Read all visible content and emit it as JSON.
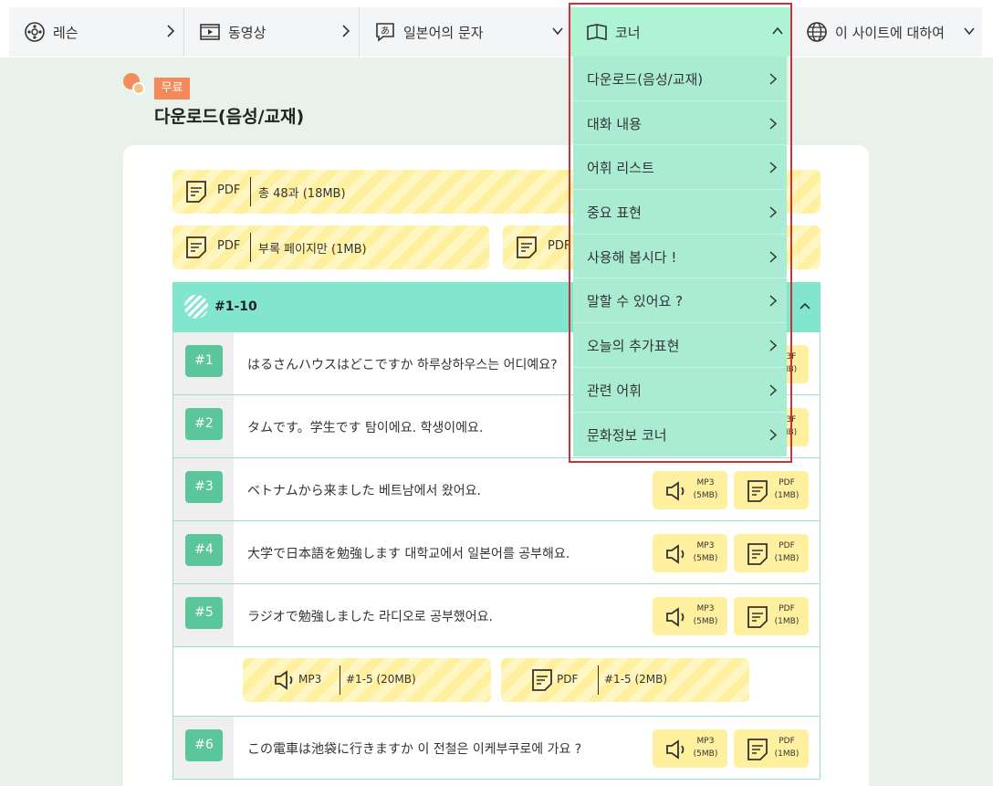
{
  "nav": {
    "items": [
      {
        "label": "레슨"
      },
      {
        "label": "동영상"
      },
      {
        "label": "일본어의 문자"
      },
      {
        "label": "코너"
      },
      {
        "label": "이 사이트에 대하여"
      }
    ]
  },
  "page": {
    "badge": "무료",
    "title": "다운로드(음성/교재)"
  },
  "downloads": {
    "all": {
      "type": "PDF",
      "info": "총 48과 (18MB)"
    },
    "appendix": {
      "type": "PDF",
      "info": "부록 페이지만 (1MB)"
    },
    "other": {
      "type": "PDF"
    }
  },
  "section": {
    "title": "#1-10"
  },
  "lessons": [
    {
      "num": "#1",
      "text": "はるさんハウスはどこですか 하루상하우스는 어디예요?"
    },
    {
      "num": "#2",
      "text": "タムです。学生です 탐이에요. 학생이에요."
    },
    {
      "num": "#3",
      "text": "ベトナムから来ました 베트남에서 왔어요."
    },
    {
      "num": "#4",
      "text": "大学で日本語を勉強します 대학교에서 일본어를 공부해요."
    },
    {
      "num": "#5",
      "text": "ラジオで勉強しました 라디오로 공부했어요."
    },
    {
      "num": "#6",
      "text": "この電車は池袋に行きますか 이 전철은 이케부쿠로에 가요 ?"
    }
  ],
  "media": {
    "mp3_label": "MP3",
    "mp3_size": "(5MB)",
    "pdf_label": "PDF",
    "pdf_size": "(1MB)",
    "partial_mp3": "3F",
    "partial_size": "IB)"
  },
  "bundle": {
    "mp3_type": "MP3",
    "mp3_info": "#1-5 (20MB)",
    "pdf_type": "PDF",
    "pdf_info": "#1-5 (2MB)"
  },
  "dropdown": {
    "items": [
      "다운로드(음성/교재)",
      "대화 내용",
      "어휘 리스트",
      "중요 표현",
      "사용해 봅시다 !",
      "말할 수 있어요 ?",
      "오늘의 추가표현",
      "관련 어휘",
      "문화정보 코너"
    ]
  }
}
